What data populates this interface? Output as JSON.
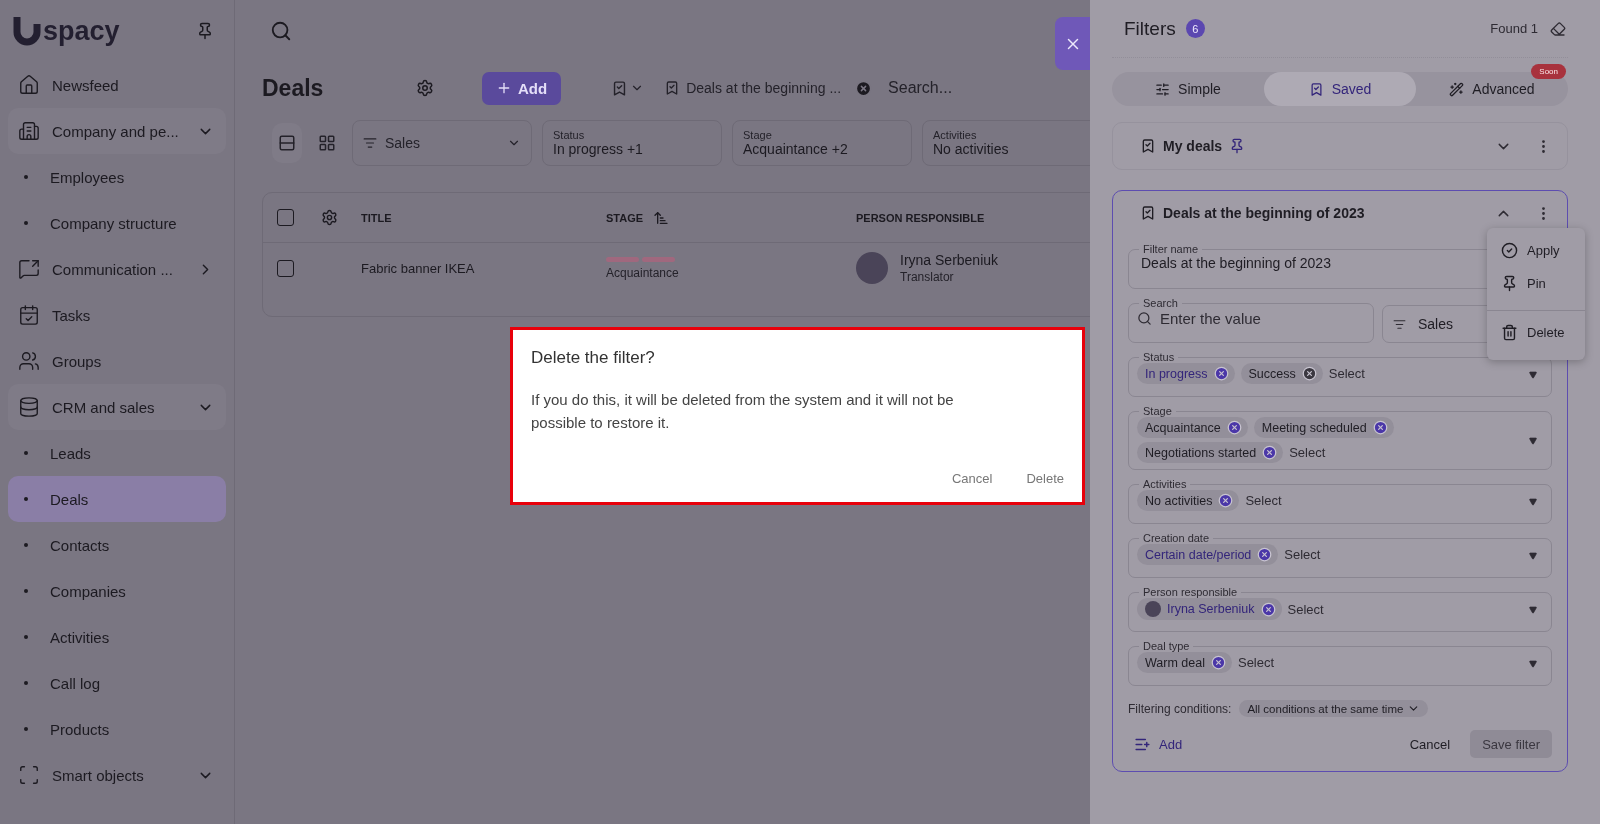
{
  "sidebar": {
    "logo": "spacy",
    "items": [
      {
        "label": "Newsfeed",
        "selected": false
      },
      {
        "label": "Company and pe...",
        "selected": false,
        "expanded": true,
        "children": [
          {
            "label": "Employees",
            "selected": false
          },
          {
            "label": "Company structure",
            "selected": false
          }
        ]
      },
      {
        "label": "Communication ...",
        "selected": false,
        "expanded": false
      },
      {
        "label": "Tasks",
        "selected": false
      },
      {
        "label": "Groups",
        "selected": false
      },
      {
        "label": "CRM and sales",
        "selected": false,
        "expanded": true,
        "children": [
          {
            "label": "Leads",
            "selected": false
          },
          {
            "label": "Deals",
            "selected": true
          },
          {
            "label": "Contacts",
            "selected": false
          },
          {
            "label": "Companies",
            "selected": false
          },
          {
            "label": "Activities",
            "selected": false
          },
          {
            "label": "Call log",
            "selected": false
          },
          {
            "label": "Products",
            "selected": false
          }
        ]
      },
      {
        "label": "Smart objects",
        "selected": false,
        "expanded": true
      }
    ]
  },
  "page": {
    "title": "Deals",
    "add_button": "Add",
    "saved_filter": "Deals at the beginning ...",
    "search": {
      "placeholder": "Search..."
    }
  },
  "filter_bar": {
    "pipeline": "Sales",
    "filters": [
      {
        "label": "Status",
        "value": "In progress",
        "extra": "+1"
      },
      {
        "label": "Stage",
        "value": "Acquaintance",
        "extra": "+2"
      },
      {
        "label": "Activities",
        "value": "No activities"
      }
    ]
  },
  "table": {
    "all_checked": false,
    "columns": [
      "TITLE",
      "STAGE",
      "PERSON RESPONSIBLE"
    ],
    "rows": [
      {
        "checked": false,
        "title": "Fabric banner IKEA",
        "stage": "Acquaintance",
        "person": "Iryna Serbeniuk",
        "role": "Translator"
      }
    ]
  },
  "filters_panel": {
    "title": "Filters",
    "count": "6",
    "found": "Found 1",
    "tabs": [
      {
        "label": "Simple",
        "selected": false
      },
      {
        "label": "Saved",
        "selected": true
      },
      {
        "label": "Advanced",
        "selected": false,
        "badge": "Soon"
      }
    ],
    "saved_filters": [
      {
        "name": "My deals",
        "pinned": true,
        "expanded": false
      },
      {
        "name": "Deals at the beginning of 2023",
        "pinned": false,
        "expanded": true
      }
    ],
    "form": {
      "filter_name": {
        "label": "Filter name",
        "value": "Deals at the beginning of 2023"
      },
      "search": {
        "label": "Search",
        "placeholder": "Enter the value"
      },
      "pipeline": "Sales",
      "fields": [
        {
          "label": "Status",
          "placeholder": "Select",
          "chips": [
            {
              "text": "In progress",
              "highlighted": true
            },
            {
              "text": "Success",
              "highlighted": false
            }
          ]
        },
        {
          "label": "Stage",
          "placeholder": "Select",
          "chips": [
            {
              "text": "Acquaintance",
              "highlighted": false
            },
            {
              "text": "Meeting scheduled",
              "highlighted": false
            },
            {
              "text": "Negotiations started",
              "highlighted": false
            }
          ]
        },
        {
          "label": "Activities",
          "placeholder": "Select",
          "chips": [
            {
              "text": "No activities",
              "highlighted": false
            }
          ]
        },
        {
          "label": "Creation date",
          "placeholder": "Select",
          "chips": [
            {
              "text": "Certain date/period",
              "highlighted": true
            }
          ]
        },
        {
          "label": "Person responsible",
          "placeholder": "Select",
          "chips": [
            {
              "text": "Iryna Serbeniuk",
              "highlighted": true,
              "kind": "person"
            }
          ]
        },
        {
          "label": "Deal type",
          "placeholder": "Select",
          "chips": [
            {
              "text": "Warm deal",
              "highlighted": false
            }
          ]
        }
      ],
      "conditions_label": "Filtering conditions:",
      "conditions_value": "All conditions at the same time",
      "add": "Add",
      "cancel": "Cancel",
      "save": {
        "label": "Save filter",
        "disabled": true
      }
    },
    "menu": [
      {
        "label": "Apply",
        "kind": "apply"
      },
      {
        "label": "Pin",
        "kind": "pin"
      },
      {
        "label": "Delete",
        "kind": "delete"
      }
    ]
  },
  "dialog": {
    "title": "Delete the filter?",
    "text": "If you do this, it will be deleted from the system and it will not be possible to restore it.",
    "buttons": [
      "Cancel",
      "Delete"
    ]
  }
}
